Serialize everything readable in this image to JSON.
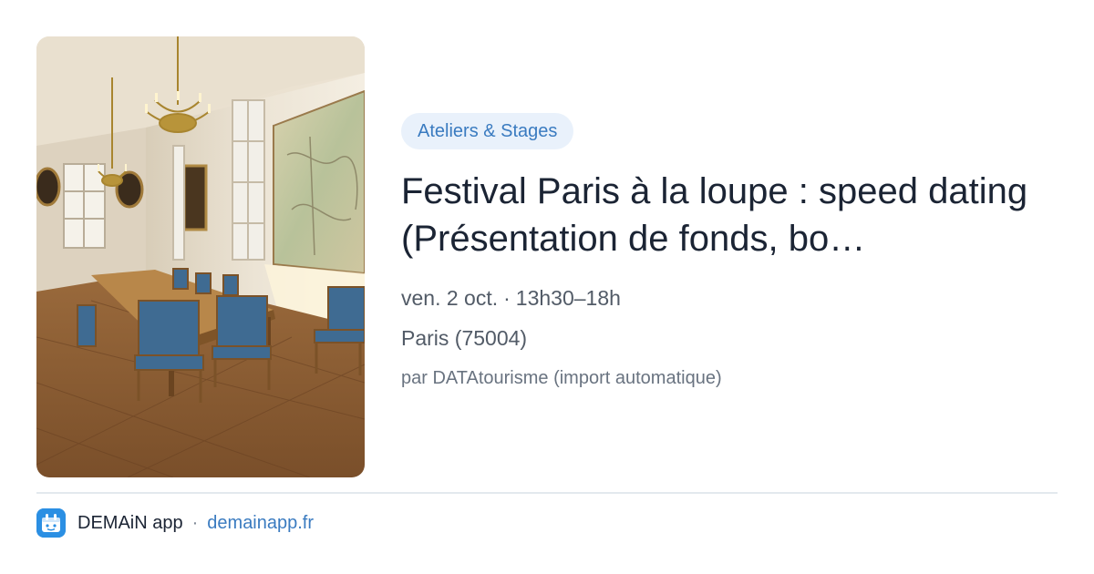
{
  "event": {
    "image_alt": "Salle historique avec lustres, table de réunion et chaises bleues",
    "category": "Ateliers & Stages",
    "title": "Festival Paris à la loupe : speed dating (Présentation de fonds, bo…",
    "date": "ven. 2 oct.",
    "time": "13h30–18h",
    "location": "Paris (75004)",
    "source": "par DATAtourisme (import automatique)"
  },
  "footer": {
    "app_name": "DEMAiN app",
    "separator": "·",
    "app_url": "demainapp.fr"
  },
  "colors": {
    "category_bg": "#e9f1fb",
    "category_text": "#3a7bc0",
    "link": "#3a7bc0",
    "app_icon": "#2b8fe3",
    "title": "#1b2434"
  },
  "icons": {
    "app_icon": "demain-app-logo-icon"
  }
}
